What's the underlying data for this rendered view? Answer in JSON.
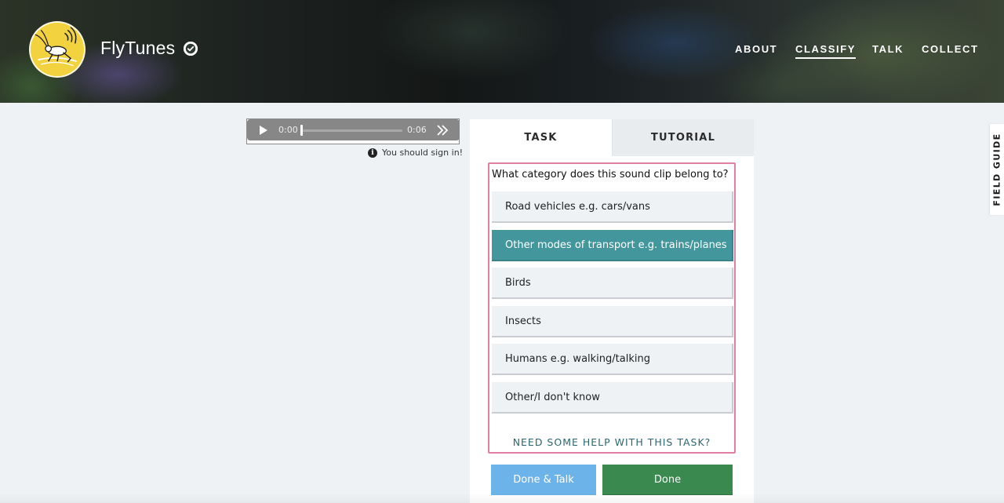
{
  "project": {
    "title": "FlyTunes",
    "verified_icon": "check-circle-icon",
    "logo_icon": "cricket-logo-icon",
    "logo_color": "#f2d23e"
  },
  "nav": {
    "items": [
      {
        "label": "ABOUT",
        "active": false
      },
      {
        "label": "CLASSIFY",
        "active": true
      },
      {
        "label": "TALK",
        "active": false
      },
      {
        "label": "COLLECT",
        "active": false
      }
    ]
  },
  "audio": {
    "current_time": "0:00",
    "duration": "0:06",
    "progress": 0,
    "play_icon": "play-icon",
    "forward_icon": "fast-forward-icon"
  },
  "signin_note": {
    "icon": "info-icon",
    "text": "You should sign in!"
  },
  "task": {
    "tabs": [
      "TASK",
      "TUTORIAL"
    ],
    "active_tab": "TASK",
    "question": "What category does this sound clip belong to?",
    "answers": [
      {
        "label": "Road vehicles e.g. cars/vans",
        "selected": false
      },
      {
        "label": "Other modes of transport e.g. trains/planes",
        "selected": true
      },
      {
        "label": "Birds",
        "selected": false
      },
      {
        "label": "Insects",
        "selected": false
      },
      {
        "label": "Humans e.g. walking/talking",
        "selected": false
      },
      {
        "label": "Other/I don't know",
        "selected": false
      }
    ],
    "help_link": "NEED SOME HELP WITH THIS TASK?",
    "done_talk_label": "Done & Talk",
    "done_label": "Done",
    "highlight_color": "#e07fa3",
    "selected_color": "#43979c"
  },
  "field_guide": {
    "label": "FIELD GUIDE"
  }
}
